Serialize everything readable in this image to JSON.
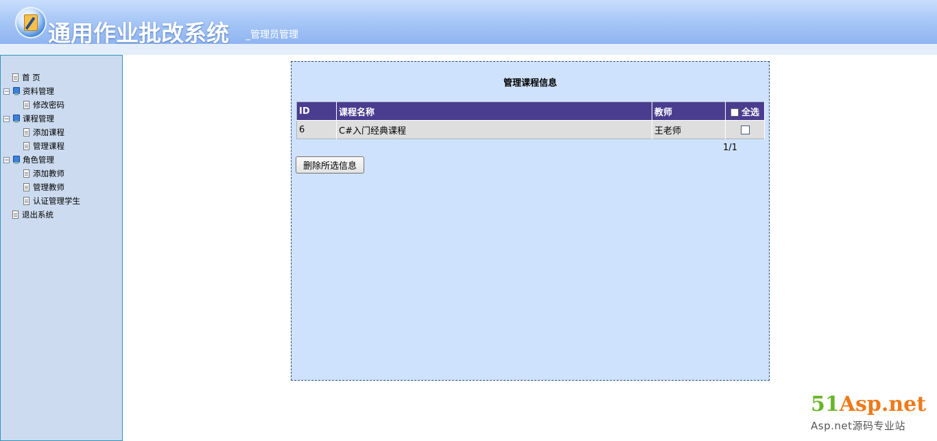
{
  "header": {
    "title": "通用作业批改系统",
    "subtitle": "_管理员管理"
  },
  "sidebar": {
    "items": [
      {
        "label": "首 页",
        "level": 0,
        "type": "doc",
        "expandable": false
      },
      {
        "label": "资料管理",
        "level": 0,
        "type": "folder",
        "expandable": true,
        "toggle": "⊟"
      },
      {
        "label": "修改密码",
        "level": 1,
        "type": "doc",
        "expandable": false
      },
      {
        "label": "课程管理",
        "level": 0,
        "type": "folder",
        "expandable": true,
        "toggle": "⊟"
      },
      {
        "label": "添加课程",
        "level": 1,
        "type": "doc",
        "expandable": false
      },
      {
        "label": "管理课程",
        "level": 1,
        "type": "doc",
        "expandable": false
      },
      {
        "label": "角色管理",
        "level": 0,
        "type": "folder",
        "expandable": true,
        "toggle": "⊟"
      },
      {
        "label": "添加教师",
        "level": 1,
        "type": "doc",
        "expandable": false
      },
      {
        "label": "管理教师",
        "level": 1,
        "type": "doc",
        "expandable": false
      },
      {
        "label": "认证管理学生",
        "level": 1,
        "type": "doc",
        "expandable": false
      },
      {
        "label": "退出系统",
        "level": 0,
        "type": "doc",
        "expandable": false
      }
    ]
  },
  "main": {
    "title": "管理课程信息",
    "table": {
      "headers": {
        "id": "ID",
        "name": "课程名称",
        "teacher": "教师",
        "select_all": "全选"
      },
      "rows": [
        {
          "id": "6",
          "name": "C#入门经典课程",
          "teacher": "王老师",
          "checked": false
        }
      ]
    },
    "pager": "1/1",
    "delete_button": "删除所选信息"
  },
  "watermark": {
    "brand_green": "51",
    "brand_orange": "Asp.net",
    "tagline": "Asp.net源码专业站"
  },
  "colors": {
    "header_top": "#c9defc",
    "header_bottom": "#8fb4f1",
    "sidebar_bg": "#ccdbef",
    "panel_bg": "#cfe2fd",
    "table_header": "#4a3d8f",
    "table_row": "#dedede"
  }
}
